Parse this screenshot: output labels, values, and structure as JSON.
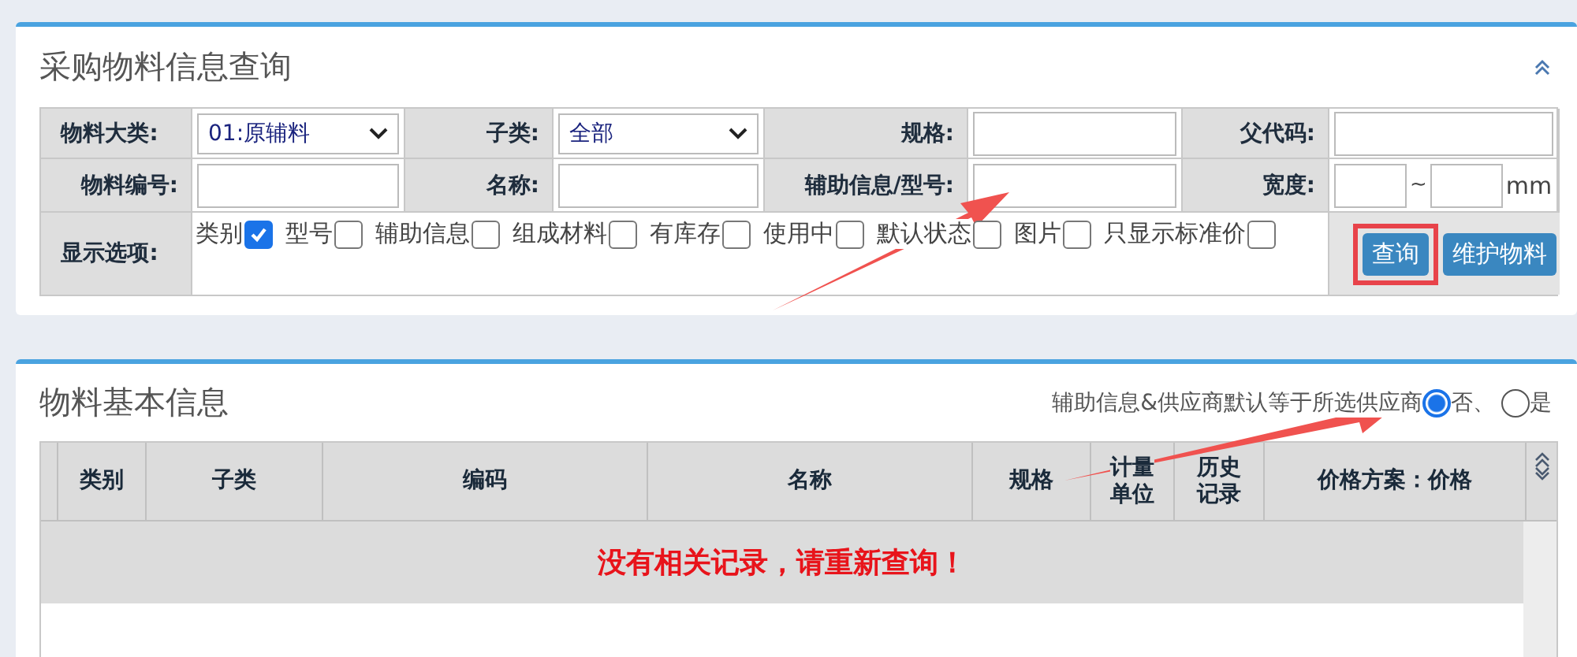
{
  "query_panel": {
    "title": "采购物料信息查询",
    "fields": [
      {
        "label": "物料大类:",
        "kind": "select",
        "value": "01:原辅料"
      },
      {
        "label": "子类:",
        "kind": "select",
        "value": "全部"
      },
      {
        "label": "规格:",
        "kind": "text"
      },
      {
        "label": "父代码:",
        "kind": "text"
      },
      {
        "label": "物料编号:",
        "kind": "text"
      },
      {
        "label": "名称:",
        "kind": "text"
      },
      {
        "label": "辅助信息/型号:",
        "kind": "text"
      },
      {
        "label": "宽度:",
        "kind": "range",
        "separator": "~",
        "unit": "mm"
      }
    ],
    "display_options": {
      "label": "显示选项:",
      "options": [
        {
          "label": "类别",
          "checked": true
        },
        {
          "label": "型号",
          "checked": false
        },
        {
          "label": "辅助信息",
          "checked": false
        },
        {
          "label": "组成材料",
          "checked": false
        },
        {
          "label": "有库存",
          "checked": false
        },
        {
          "label": "使用中",
          "checked": false
        },
        {
          "label": "默认状态",
          "checked": false
        },
        {
          "label": "图片",
          "checked": false
        },
        {
          "label": "只显示标准价",
          "checked": false
        }
      ]
    },
    "buttons": [
      {
        "label": "查询",
        "highlighted": true
      },
      {
        "label": "维护物料",
        "highlighted": false
      }
    ]
  },
  "results_panel": {
    "title": "物料基本信息",
    "supplier_default": {
      "label": "辅助信息&供应商默认等于所选供应商",
      "options": [
        {
          "label": "否、",
          "selected": true
        },
        {
          "label": "是",
          "selected": false
        }
      ]
    },
    "table": {
      "columns": [
        "类别",
        "子类",
        "编码",
        "名称",
        "规格",
        "计量单位",
        "历史记录",
        "价格方案：价格"
      ],
      "empty_message": "没有相关记录，请重新查询！"
    }
  }
}
